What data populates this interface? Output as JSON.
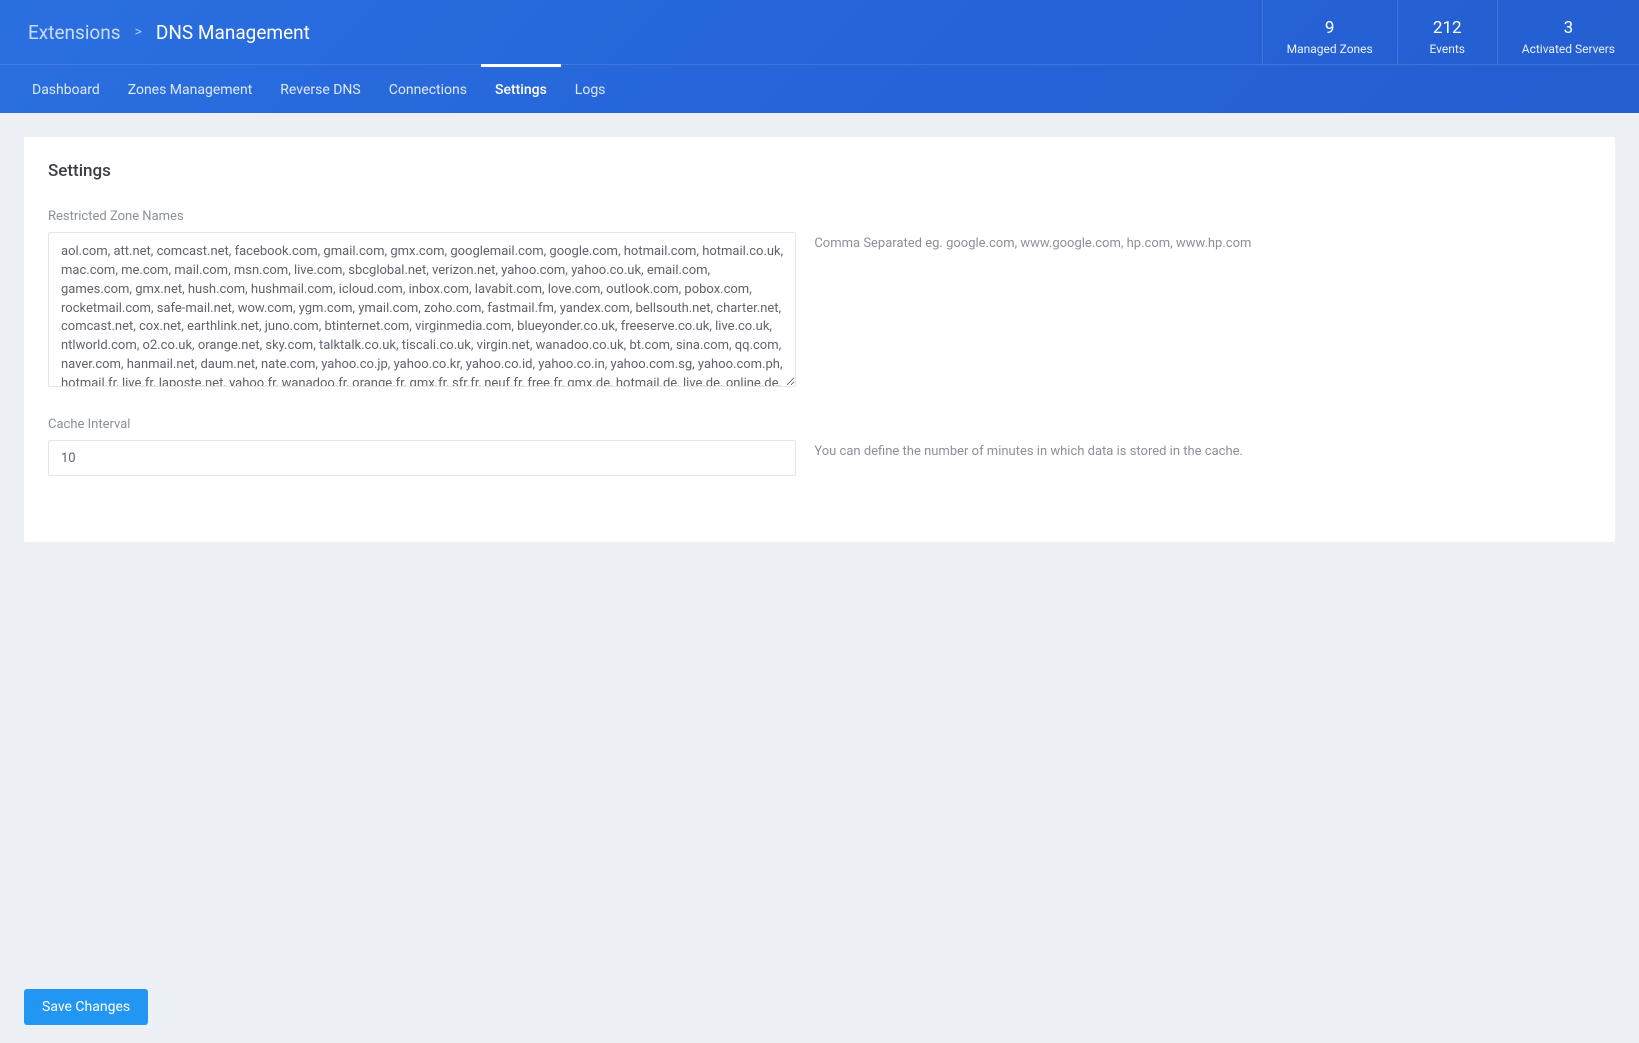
{
  "breadcrumb": {
    "parent": "Extensions",
    "separator": ">",
    "current": "DNS Management"
  },
  "stats": [
    {
      "value": "9",
      "label": "Managed Zones"
    },
    {
      "value": "212",
      "label": "Events"
    },
    {
      "value": "3",
      "label": "Activated Servers"
    }
  ],
  "tabs": [
    {
      "label": "Dashboard",
      "active": false
    },
    {
      "label": "Zones Management",
      "active": false
    },
    {
      "label": "Reverse DNS",
      "active": false
    },
    {
      "label": "Connections",
      "active": false
    },
    {
      "label": "Settings",
      "active": true
    },
    {
      "label": "Logs",
      "active": false
    }
  ],
  "settings": {
    "page_title": "Settings",
    "restricted_zones": {
      "label": "Restricted Zone Names",
      "value": "aol.com, att.net, comcast.net, facebook.com, gmail.com, gmx.com, googlemail.com, google.com, hotmail.com, hotmail.co.uk, mac.com, me.com, mail.com, msn.com, live.com, sbcglobal.net, verizon.net, yahoo.com, yahoo.co.uk, email.com, games.com, gmx.net, hush.com, hushmail.com, icloud.com, inbox.com, lavabit.com, love.com, outlook.com, pobox.com, rocketmail.com, safe-mail.net, wow.com, ygm.com, ymail.com, zoho.com, fastmail.fm, yandex.com, bellsouth.net, charter.net, comcast.net, cox.net, earthlink.net, juno.com, btinternet.com, virginmedia.com, blueyonder.co.uk, freeserve.co.uk, live.co.uk, ntlworld.com, o2.co.uk, orange.net, sky.com, talktalk.co.uk, tiscali.co.uk, virgin.net, wanadoo.co.uk, bt.com, sina.com, qq.com, naver.com, hanmail.net, daum.net, nate.com, yahoo.co.jp, yahoo.co.kr, yahoo.co.id, yahoo.co.in, yahoo.com.sg, yahoo.com.ph, hotmail.fr, live.fr, laposte.net, yahoo.fr, wanadoo.fr, orange.fr, gmx.fr, sfr.fr, neuf.fr, free.fr, gmx.de, hotmail.de, live.de, online.de, t-online.de, web.de, yahoo.de, mail.ru, rambler.ru, yandex.ru, ya.ru, list.ru, hotmail.be, live.be, skynet.be, voo.be, tvcablenet.be, telenet.be, hotmail.com.ar, live.com.ar, yahoo.com.ar, fibertel.com.ar, speedy.com.ar, arnet.com.ar",
      "help": "Comma Separated eg. google.com, www.google.com, hp.com, www.hp.com"
    },
    "cache_interval": {
      "label": "Cache Interval",
      "value": "10",
      "help": "You can define the number of minutes in which data is stored in the cache."
    }
  },
  "actions": {
    "save_label": "Save Changes"
  }
}
